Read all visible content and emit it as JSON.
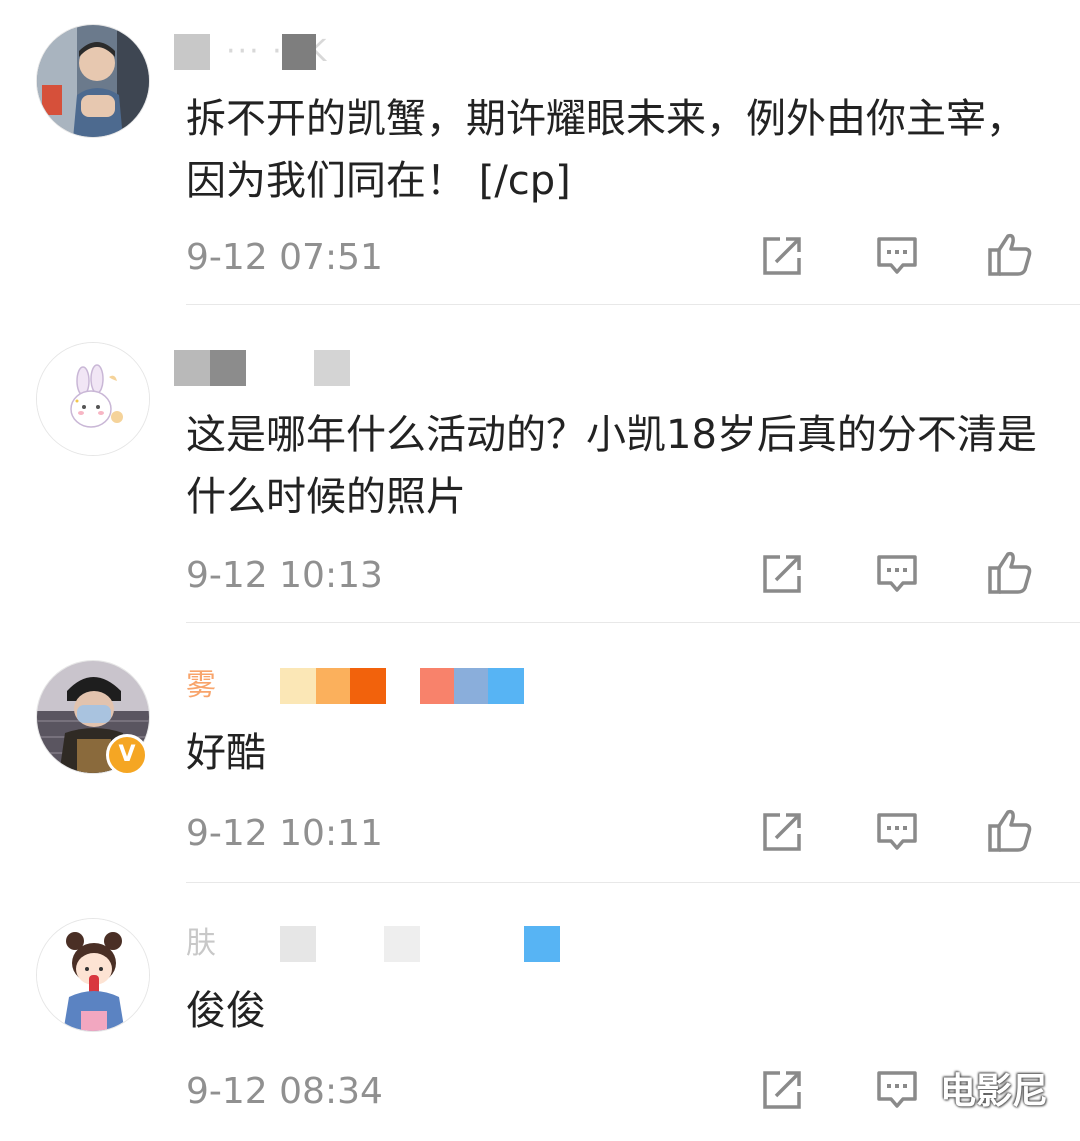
{
  "comments": [
    {
      "username": "··· ·· K",
      "username_visible": "K",
      "text": "拆不开的凯蟹，期许耀眼未来，例外由你主宰，因为我们同在！ [/cp]",
      "time": "9-12 07:51",
      "avatar_icon": "user-avatar-icon",
      "verified": false
    },
    {
      "username": "",
      "text": "这是哪年什么活动的？小凯18岁后真的分不清是什么时候的照片",
      "time": "9-12 10:13",
      "avatar_icon": "bunny-avatar-icon",
      "verified": false
    },
    {
      "username": "雾",
      "text": "好酷",
      "time": "9-12 10:11",
      "avatar_icon": "masked-user-avatar-icon",
      "verified": true,
      "verified_mark": "V"
    },
    {
      "username": "肤",
      "text": "俊俊",
      "time": "9-12 08:34",
      "avatar_icon": "girl-avatar-icon",
      "verified": false
    }
  ],
  "actions": {
    "share_icon": "share-icon",
    "reply_icon": "comment-icon",
    "like_icon": "thumbs-up-icon"
  },
  "watermark": "电影尼",
  "colors": {
    "text": "#222222",
    "timestamp": "#909090",
    "icon": "#8a8a8a",
    "divider": "#e8e8e8",
    "vip_orange": "#f5a623",
    "username_orange": "#f8a46b"
  }
}
